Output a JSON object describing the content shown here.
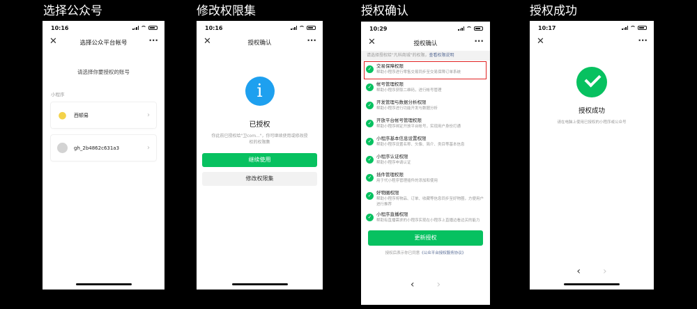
{
  "titles": [
    "选择公众号",
    "修改权限集",
    "授权确认",
    "授权成功"
  ],
  "phone1": {
    "time": "10:16",
    "nav_title": "选择公众平台帐号",
    "prompt": "请选择你要授权的账号",
    "section_label": "小程序",
    "accounts": [
      {
        "name": "西顿易"
      },
      {
        "name": "gh_2b4862c631a3"
      }
    ]
  },
  "phone2": {
    "time": "10:16",
    "nav_title": "授权确认",
    "status_title": "已授权",
    "desc": "你此前已授权给\"卫com...\"，你可继续使用或修改授权的权限集",
    "continue_label": "继续使用",
    "modify_label": "修改权限集"
  },
  "phone3": {
    "time": "10:29",
    "nav_title": "授权确认",
    "tip": "请选择授权给\"凡科商城\"的权限，",
    "tip_link": "查看权限说明",
    "permissions": [
      {
        "name": "交易保障权限",
        "desc": "帮助小程序进行零售交易同步至交易保障订单系统"
      },
      {
        "name": "帐号管理权限",
        "desc": "帮助小程序获取二维码，进行帐号管理"
      },
      {
        "name": "开发管理与数据分析权限",
        "desc": "帮助小程序进行功能开发与数据分析"
      },
      {
        "name": "开放平台帐号管理权限",
        "desc": "帮助小程序绑定开放平台帐号，实现用户身份打通"
      },
      {
        "name": "小程序基本信息设置权限",
        "desc": "帮助小程序设置名称、头像、简介、类目等基本信息"
      },
      {
        "name": "小程序认证权限",
        "desc": "帮助小程序申请认证"
      },
      {
        "name": "插件管理权限",
        "desc": "用于代小程序管理插件的添加和使用"
      },
      {
        "name": "好物圈权限",
        "desc": "帮助小程序将物品、订单、收藏等信息同步至好物圈，方便用户进行推荐"
      },
      {
        "name": "小程序直播权限",
        "desc": "帮助有直播需求的小程序实现在小程序上直播边看边买的能力"
      }
    ],
    "update_label": "更新授权",
    "agree_text": "授权后表示你已同意",
    "agree_link": "《公众平台授权服务协议》"
  },
  "phone4": {
    "time": "10:17",
    "status_title": "授权成功",
    "desc": "请在电脑上使用已授权的小程序或公众号"
  },
  "colors": {
    "green": "#07c160",
    "info_blue": "#1ea0ef",
    "highlight_red": "#e02020",
    "link": "#576b95"
  },
  "icons": {
    "close": "close-icon",
    "more": "more-icon",
    "chevron": "chevron-right-icon",
    "back": "back-arrow-icon",
    "forward": "forward-arrow-icon",
    "check": "check-circle-icon",
    "info": "info-icon"
  }
}
